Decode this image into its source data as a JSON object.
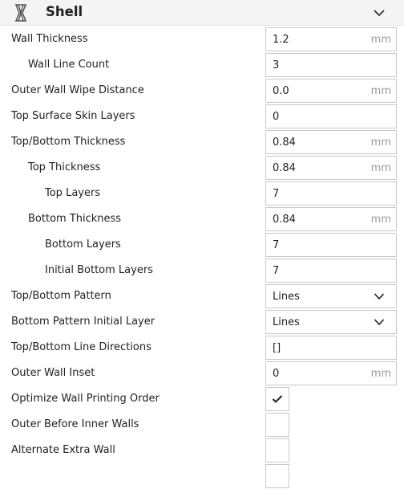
{
  "header": {
    "title": "Shell",
    "icon": "shell-icon",
    "collapse_icon": "chevron-down-icon"
  },
  "settings": [
    {
      "label": "Wall Thickness",
      "indent": 0,
      "type": "number",
      "value": "1.2",
      "unit": "mm"
    },
    {
      "label": "Wall Line Count",
      "indent": 1,
      "type": "number",
      "value": "3",
      "unit": ""
    },
    {
      "label": "Outer Wall Wipe Distance",
      "indent": 0,
      "type": "number",
      "value": "0.0",
      "unit": "mm"
    },
    {
      "label": "Top Surface Skin Layers",
      "indent": 0,
      "type": "number",
      "value": "0",
      "unit": ""
    },
    {
      "label": "Top/Bottom Thickness",
      "indent": 0,
      "type": "number",
      "value": "0.84",
      "unit": "mm"
    },
    {
      "label": "Top Thickness",
      "indent": 1,
      "type": "number",
      "value": "0.84",
      "unit": "mm"
    },
    {
      "label": "Top Layers",
      "indent": 2,
      "type": "number",
      "value": "7",
      "unit": ""
    },
    {
      "label": "Bottom Thickness",
      "indent": 1,
      "type": "number",
      "value": "0.84",
      "unit": "mm"
    },
    {
      "label": "Bottom Layers",
      "indent": 2,
      "type": "number",
      "value": "7",
      "unit": ""
    },
    {
      "label": "Initial Bottom Layers",
      "indent": 2,
      "type": "number",
      "value": "7",
      "unit": ""
    },
    {
      "label": "Top/Bottom Pattern",
      "indent": 0,
      "type": "select",
      "value": "Lines",
      "unit": ""
    },
    {
      "label": "Bottom Pattern Initial Layer",
      "indent": 0,
      "type": "select",
      "value": "Lines",
      "unit": ""
    },
    {
      "label": "Top/Bottom Line Directions",
      "indent": 0,
      "type": "text",
      "value": "[]",
      "unit": ""
    },
    {
      "label": "Outer Wall Inset",
      "indent": 0,
      "type": "number",
      "value": "0",
      "unit": "mm"
    },
    {
      "label": "Optimize Wall Printing Order",
      "indent": 0,
      "type": "checkbox",
      "checked": true
    },
    {
      "label": "Outer Before Inner Walls",
      "indent": 0,
      "type": "checkbox",
      "checked": false
    },
    {
      "label": "Alternate Extra Wall",
      "indent": 0,
      "type": "checkbox",
      "checked": false
    },
    {
      "label": "",
      "indent": 0,
      "type": "checkbox",
      "checked": false
    }
  ]
}
